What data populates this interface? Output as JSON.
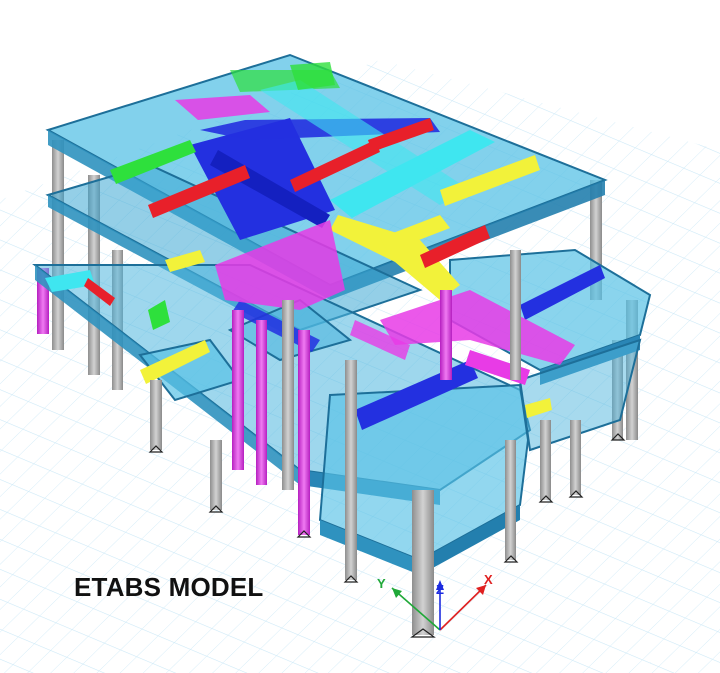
{
  "caption": "ETABS MODEL",
  "axes": {
    "x": "X",
    "y": "Y",
    "z": "Z"
  },
  "colors": {
    "background": "#ffffff",
    "grid": "#bfe3f5",
    "slab_top": "#58c2e6",
    "slab_side": "#2f92bf",
    "slab_edge": "#1d6f99",
    "column": "#b9b9b9",
    "column_magenta": "#e23ce6",
    "beam_blue": "#2330e0",
    "beam_cyan": "#3fe6f0",
    "beam_yellow": "#f2f23a",
    "beam_red": "#e8202a",
    "beam_magenta": "#e83be6",
    "beam_green": "#2ee03c",
    "axis_x": "#e02020",
    "axis_y": "#1fa838",
    "axis_z": "#1c2be0"
  }
}
